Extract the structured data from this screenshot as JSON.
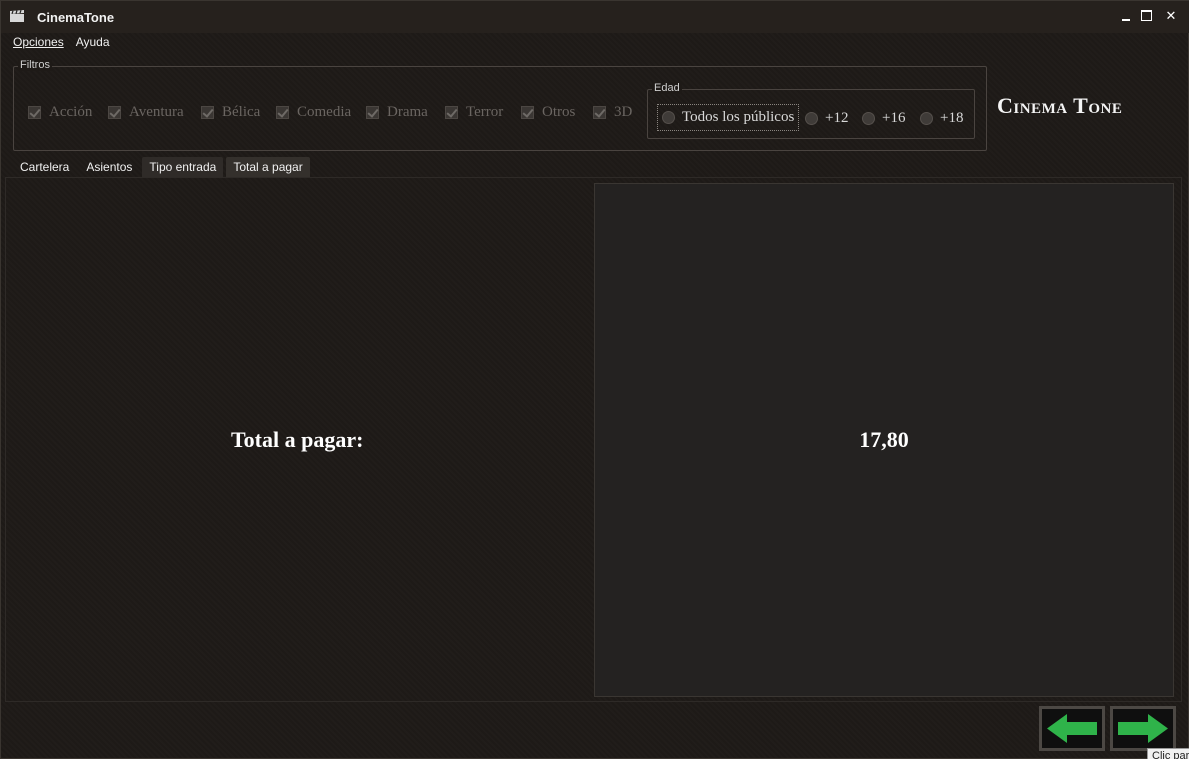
{
  "window": {
    "title": "CinemaTone",
    "controls": {
      "minimize": "minimize",
      "maximize": "maximize",
      "close": "✕"
    }
  },
  "menu": {
    "items": [
      {
        "label": "Opciones"
      },
      {
        "label": "Ayuda"
      }
    ]
  },
  "filters": {
    "legend": "Filtros",
    "genres": [
      {
        "label": "Acción",
        "checked": true
      },
      {
        "label": "Aventura",
        "checked": true
      },
      {
        "label": "Bélica",
        "checked": true
      },
      {
        "label": "Comedia",
        "checked": true
      },
      {
        "label": "Drama",
        "checked": true
      },
      {
        "label": "Terror",
        "checked": true
      },
      {
        "label": "Otros",
        "checked": true
      },
      {
        "label": "3D",
        "checked": true
      }
    ],
    "age": {
      "legend": "Edad",
      "options": [
        {
          "label": "Todos los públicos"
        },
        {
          "label": "+12"
        },
        {
          "label": "+16"
        },
        {
          "label": "+18"
        }
      ]
    }
  },
  "brand": "Cinema Tone",
  "tabs": [
    {
      "label": "Cartelera"
    },
    {
      "label": "Asientos"
    },
    {
      "label": "Tipo entrada"
    },
    {
      "label": "Total a pagar"
    }
  ],
  "main": {
    "total_label": "Total a pagar:",
    "total_value": "17,80"
  },
  "navigation": {
    "back_icon": "left-arrow-icon",
    "next_icon": "right-arrow-icon",
    "arrow_color": "#2fb34a",
    "tooltip": "Clic par"
  }
}
